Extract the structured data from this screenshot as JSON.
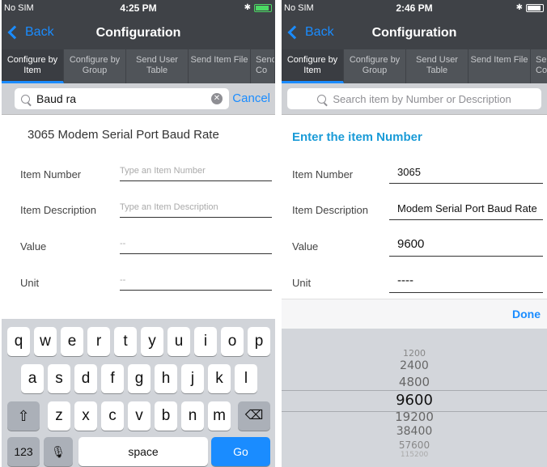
{
  "status_left": {
    "carrier": "No SIM",
    "time": "4:25 PM"
  },
  "status_right": {
    "carrier": "No SIM",
    "time": "2:46 PM"
  },
  "nav": {
    "back_label": "Back",
    "title": "Configuration"
  },
  "tabs": [
    {
      "label": "Configure by Item"
    },
    {
      "label": "Configure by Group"
    },
    {
      "label": "Send User Table"
    },
    {
      "label": "Send Item File"
    },
    {
      "label": "Send Co"
    }
  ],
  "left": {
    "search_value": "Baud ra",
    "cancel_label": "Cancel",
    "result_text": "3065 Modem Serial Port Baud Rate",
    "fields": [
      {
        "label": "Item Number",
        "placeholder": "Type an Item Number"
      },
      {
        "label": "Item Description",
        "placeholder": "Type an Item Description"
      },
      {
        "label": "Value",
        "placeholder": "--"
      },
      {
        "label": "Unit",
        "placeholder": "--"
      }
    ]
  },
  "right": {
    "search_placeholder": "Search item by Number or Description",
    "prompt": "Enter the item Number",
    "fields": [
      {
        "label": "Item Number",
        "value": "3065"
      },
      {
        "label": "Item Description",
        "value": "Modem Serial Port Baud Rate"
      },
      {
        "label": "Value",
        "value": "9600"
      },
      {
        "label": "Unit",
        "value": "----"
      }
    ],
    "done_label": "Done",
    "picker_options": [
      "1200",
      "2400",
      "4800",
      "9600",
      "19200",
      "38400",
      "57600",
      "115200"
    ],
    "picker_selected": "9600"
  },
  "keyboard": {
    "row1": [
      "q",
      "w",
      "e",
      "r",
      "t",
      "y",
      "u",
      "i",
      "o",
      "p"
    ],
    "row2": [
      "a",
      "s",
      "d",
      "f",
      "g",
      "h",
      "j",
      "k",
      "l"
    ],
    "row3": [
      "z",
      "x",
      "c",
      "v",
      "b",
      "n",
      "m"
    ],
    "numbers_label": "123",
    "space_label": "space",
    "go_label": "Go"
  },
  "colors": {
    "accent": "#1a8cff",
    "nav_bg": "#3f4247",
    "prompt": "#1a9bd7"
  }
}
